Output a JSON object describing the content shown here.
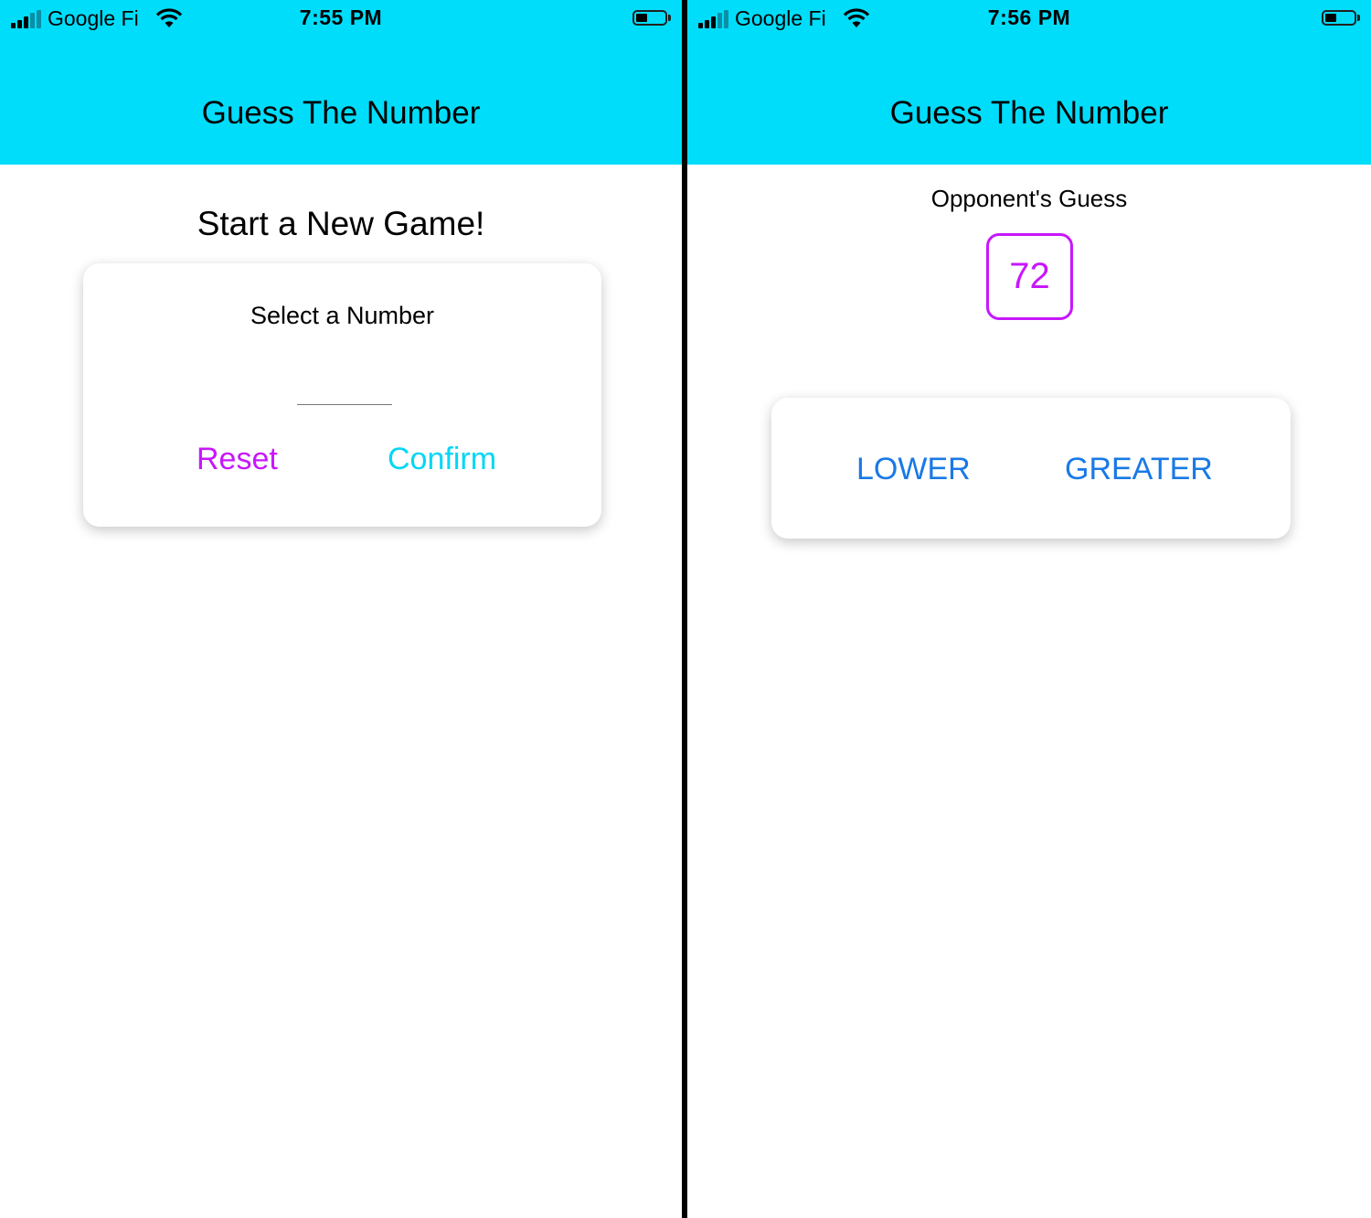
{
  "left_screen": {
    "status_bar": {
      "carrier": "Google Fi",
      "time": "7:55 PM"
    },
    "header": {
      "title": "Guess The Number"
    },
    "title": "Start a New Game!",
    "card": {
      "label": "Select a Number",
      "input_value": "",
      "reset_label": "Reset",
      "confirm_label": "Confirm"
    }
  },
  "right_screen": {
    "status_bar": {
      "carrier": "Google Fi",
      "time": "7:56 PM"
    },
    "header": {
      "title": "Guess The Number"
    },
    "opponent_label": "Opponent's Guess",
    "opponent_guess": "72",
    "card": {
      "lower_label": "LOWER",
      "greater_label": "GREATER"
    }
  },
  "colors": {
    "header": "#00ddfb",
    "primary": "#c717fc",
    "accent": "#00d7f5",
    "button_text": "#1979e6"
  },
  "icons": [
    "signal-icon",
    "wifi-icon",
    "battery-icon"
  ]
}
